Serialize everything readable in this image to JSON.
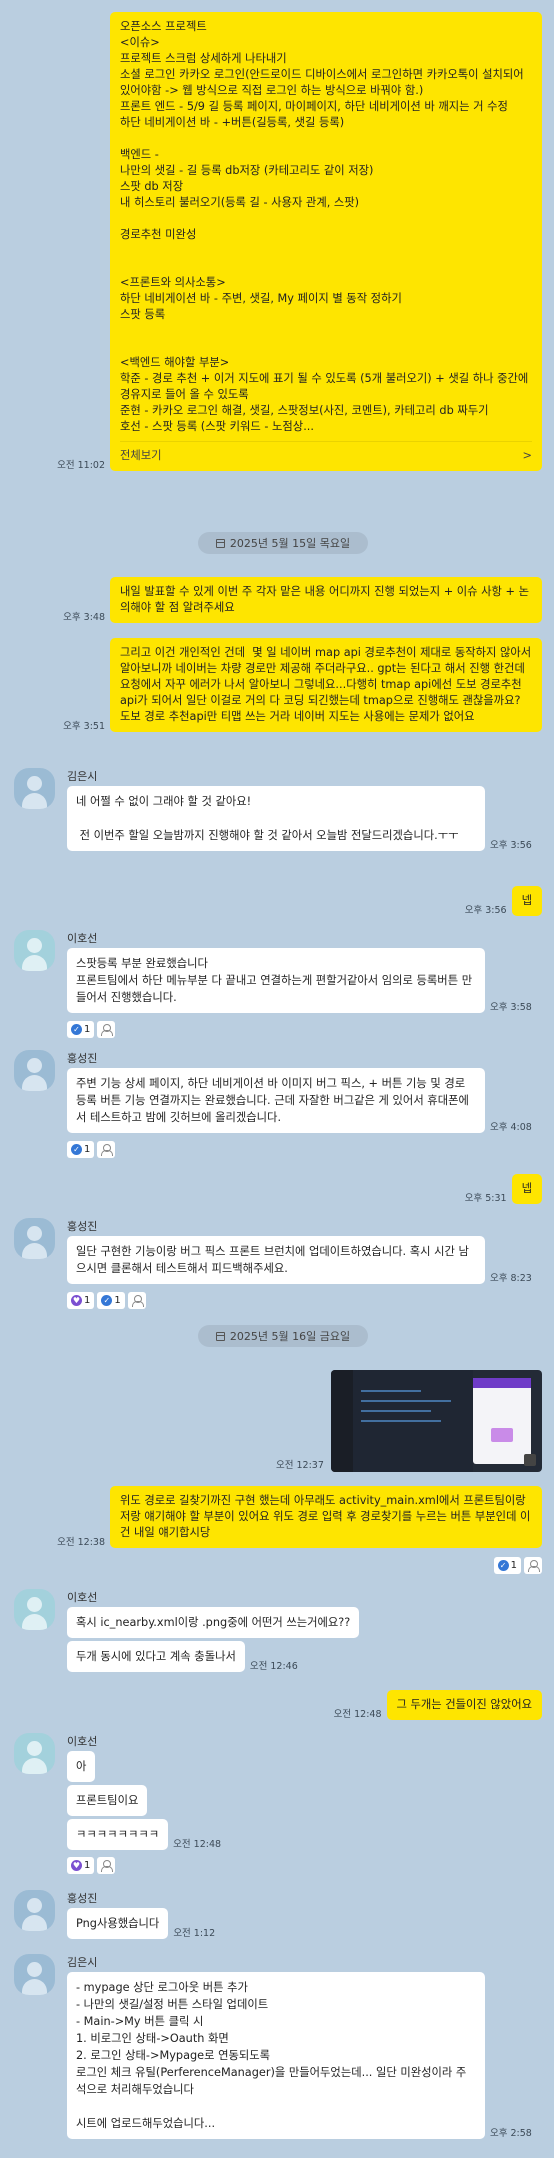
{
  "messages": {
    "m1": {
      "text": "오픈소스 프로젝트\n<이슈>\n프로젝트 스크럼 상세하게 나타내기\n소셜 로그인 카카오 로그인(안드로이드 디바이스에서 로그인하면 카카오톡이 설치되어 있어야함 -> 웹 방식으로 직접 로그인 하는 방식으로 바꿔야 함.)\n프론트 엔드 - 5/9 길 등록 페이지, 마이페이지, 하단 네비게이션 바 깨지는 거 수정\n하단 네비게이션 바 - +버튼(길등록, 샛길 등록)\n\n백엔드 -\n나만의 샛길 - 길 등록 db저장 (카테고리도 같이 저장)\n스팟 db 저장\n내 히스토리 불러오기(등록 길 - 사용자 관계, 스팟)\n\n경로추천 미완성\n\n\n<프론트와 의사소통>\n하단 네비게이션 바 - 주변, 샛길, My 페이지 별 동작 정하기\n스팟 등록\n\n\n<백엔드 해야할 부분>\n학준 - 경로 추천 + 이거 지도에 표기 될 수 있도록 (5개 불러오기) + 샛길 하나 중간에 경유지로 들어 올 수 있도록\n준현 - 카카오 로그인 해결, 샛길, 스팟정보(사진, 코멘트), 카테고리 db 짜두기\n호선 - 스팟 등록 (스팟 키워드 - 노점상...",
      "see_all": "전체보기",
      "chevron": ">",
      "time": "오전 11:02"
    },
    "date1": "2025년 5월 15일 목요일",
    "m2": {
      "text": "내일 발표할 수 있게 이번 주 각자 맡은 내용 어디까지 진행 되었는지 + 이슈 사항 + 논의해야 할 점 알려주세요",
      "time": "오후 3:48"
    },
    "m3": {
      "text": "그리고 이건 개인적인 건데  몇 일 네이버 map api 경로추천이 제대로 동작하지 않아서 알아보니까 네이버는 차량 경로만 제공해 주더라구요.. gpt는 된다고 해서 진행 한건데 요청에서 자꾸 에러가 나서 알아보니 그렇네요...다행히 tmap api에선 도보 경로추천 api가 되어서 일단 이걸로 거의 다 코딩 되긴했는데 tmap으로 진행해도 괜찮을까요? 도보 경로 추천api만 티맵 쓰는 거라 네이버 지도는 사용에는 문제가 없어요",
      "time": "오후 3:51"
    },
    "m4": {
      "name": "김은시",
      "text": "네 어쩔 수 없이 그래야 할 것 같아요!\n\n 전 이번주 할일 오늘밤까지 진행해야 할 것 같아서 오늘밤 전달드리겠습니다.ㅜㅜ",
      "time": "오후 3:56"
    },
    "m5": {
      "text": "넵",
      "time": "오후 3:56"
    },
    "m6": {
      "name": "이호선",
      "text": "스팟등록 부분 완료했습니다\n프론트팀에서 하단 메뉴부분 다 끝내고 연결하는게 편할거같아서 임의로 등록버튼 만들어서 진행했습니다.",
      "time": "오후 3:58",
      "react_count": "1"
    },
    "m7": {
      "name": "홍성진",
      "text": "주변 기능 상세 페이지, 하단 네비게이션 바 이미지 버그 픽스, + 버튼 기능 및 경로 등록 버튼 기능 연결까지는 완료했습니다. 근데 자잘한 버그같은 게 있어서 휴대폰에서 테스트하고 밤에 깃허브에 올리겠습니다.",
      "time": "오후 4:08",
      "react_count": "1"
    },
    "m8": {
      "text": "넵",
      "time": "오후 5:31"
    },
    "m9": {
      "name": "홍성진",
      "text": "일단 구현한 기능이랑 버그 픽스 프론트 브런치에 업데이트하였습니다. 혹시 시간 남으시면 클론해서 테스트해서 피드백해주세요.",
      "time": "오후 8:23",
      "react_heart": "1",
      "react_check": "1"
    },
    "date2": "2025년 5월 16일 금요일",
    "m10": {
      "time": "오전 12:37"
    },
    "m11": {
      "text": "위도 경로로 길찾기까진 구현 했는데 아무래도 activity_main.xml에서 프론트팀이랑 저랑 얘기해야 할 부분이 있어요 위도 경로 입력 후 경로찾기를 누르는 버튼 부분인데 이건 내일 얘기합시당",
      "time": "오전 12:38",
      "react_count": "1"
    },
    "m12": {
      "name": "이호선",
      "text": "혹시 ic_nearby.xml이랑 .png중에 어떤거 쓰는거에요??",
      "text2": "두개 동시에 있다고 계속 충돌나서",
      "time": "오전 12:46"
    },
    "m13": {
      "text": "그 두개는 건들이진 않았어요",
      "time": "오전 12:48"
    },
    "m14": {
      "name": "이호선",
      "t1": "아",
      "t2": "프론트팀이요",
      "t3": "ㅋㅋㅋㅋㅋㅋㅋㅋ",
      "time": "오전 12:48",
      "react_heart": "1"
    },
    "m15": {
      "name": "홍성진",
      "text": "Png사용했습니다",
      "time": "오전 1:12"
    },
    "m16": {
      "name": "김은시",
      "text": "- mypage 상단 로그아웃 버튼 추가\n- 나만의 샛길/설정 버튼 스타일 업데이트\n- Main->My 버튼 클릭 시\n1. 비로그인 상태->Oauth 화면\n2. 로그인 상태->Mypage로 연동되도록\n로그인 체크 유틸(PerferenceManager)을 만들어두었는데... 일단 미완성이라 주석으로 처리해두었습니다\n\n시트에 업로드해두었습니다...",
      "time": "오후 2:58"
    }
  },
  "colors": {
    "my_bubble": "#fee500",
    "other_bubble": "#ffffff",
    "background": "#bacee0"
  }
}
